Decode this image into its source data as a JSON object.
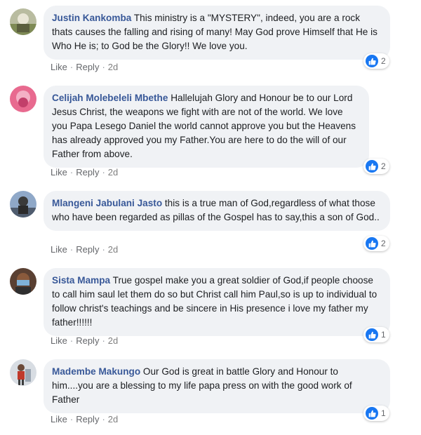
{
  "comments": [
    {
      "author": "Justin Kankomba",
      "text": "This ministry is a \"MYSTERY\", indeed, you are a rock thats causes the falling and rising of many! May God prove Himself that He is Who He is; to God be the Glory!! We love you.",
      "like_label": "Like",
      "reply_label": "Reply",
      "time": "2d",
      "reactions": "2",
      "avatar_icon": "user-photo-avatar"
    },
    {
      "author": "Celijah Molebeleli Mbethe",
      "text": "Hallelujah Glory and Honour be to our Lord Jesus Christ, the weapons we fight with are not of the world. We love you Papa Lesego Daniel the world cannot approve you but the Heavens has already approved you my Father.You are here to do the will of our Father from above.",
      "like_label": "Like",
      "reply_label": "Reply",
      "time": "2d",
      "reactions": "2",
      "avatar_icon": "user-photo-avatar"
    },
    {
      "author": "Mlangeni Jabulani Jasto",
      "text": "this is a true man of God,regardless of what those who have been regarded as pillas of the Gospel has to say,this a son of God..",
      "like_label": "Like",
      "reply_label": "Reply",
      "time": "2d",
      "reactions": "2",
      "avatar_icon": "user-photo-avatar"
    },
    {
      "author": "Sista Mampa",
      "text": "True gospel make you a great soldier of God,if people choose to call him saul let them do so but Christ call him Paul,so is up to individual to follow christ's teachings and be sincere in His presence i love my father my father!!!!!!",
      "like_label": "Like",
      "reply_label": "Reply",
      "time": "2d",
      "reactions": "1",
      "avatar_icon": "user-photo-avatar"
    },
    {
      "author": "Madembe Makungo",
      "text": "Our God is great in battle Glory and Honour to him....you are a blessing to my life papa press on with the good work of Father",
      "like_label": "Like",
      "reply_label": "Reply",
      "time": "2d",
      "reactions": "1",
      "avatar_icon": "user-photo-avatar"
    }
  ],
  "colors": {
    "author": "#385898",
    "bubble": "#f0f2f5",
    "meta": "#65676b",
    "like_badge": "#1877f2"
  }
}
